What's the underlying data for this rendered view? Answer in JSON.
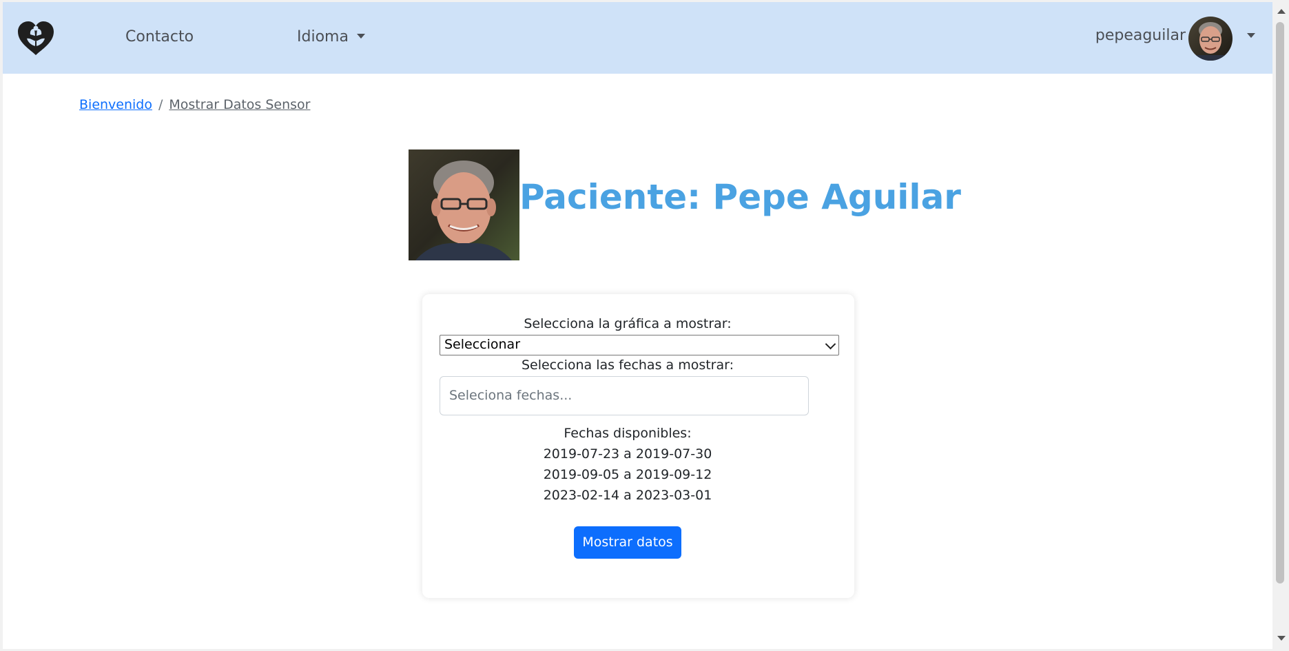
{
  "navbar": {
    "logo_icon": "heart-hands-logo-icon",
    "links": {
      "contacto": "Contacto",
      "idioma": "Idioma"
    },
    "user": {
      "name": "pepeaguilar",
      "avatar_icon": "user-avatar-photo"
    },
    "background": "#cfe2f8"
  },
  "breadcrumb": {
    "home": "Bienvenido",
    "separator": "/",
    "current": "Mostrar Datos Sensor"
  },
  "patient": {
    "title": "Paciente: Pepe Aguilar",
    "title_color": "#4aa2e2"
  },
  "form": {
    "chart_label": "Selecciona la gráfica a mostrar:",
    "chart_select_value": "Seleccionar",
    "dates_label": "Selecciona las fechas a mostrar:",
    "dates_placeholder": "Seleciona fechas...",
    "available_label": "Fechas disponibles:",
    "available_ranges": [
      "2019-07-23 a 2019-07-30",
      "2019-09-05 a 2019-09-12",
      "2023-02-14 a 2023-03-01"
    ],
    "submit_label": "Mostrar datos",
    "submit_color": "#0d6efd"
  }
}
